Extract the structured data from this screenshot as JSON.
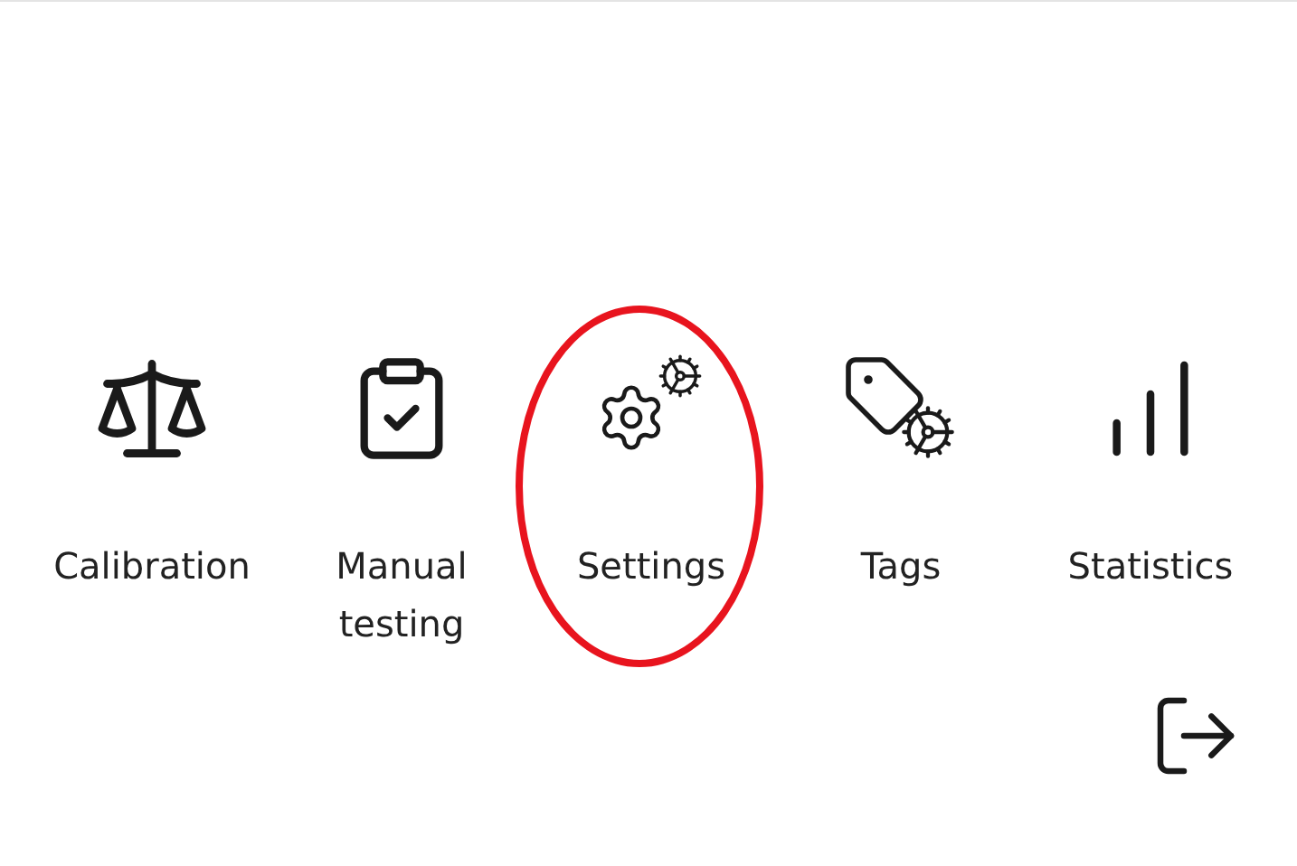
{
  "menu_items": [
    {
      "label": "Calibration",
      "highlighted": false
    },
    {
      "label": "Manual testing",
      "highlighted": false
    },
    {
      "label": "Settings",
      "highlighted": true
    },
    {
      "label": "Tags",
      "highlighted": false
    },
    {
      "label": "Statistics",
      "highlighted": false
    }
  ]
}
